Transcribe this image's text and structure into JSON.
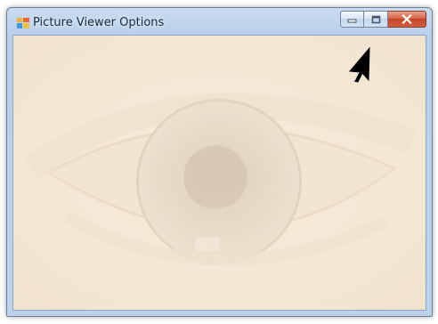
{
  "window": {
    "title": "Picture Viewer Options"
  },
  "caption_buttons": [
    {
      "name": "minimize",
      "icon": "minimize-icon"
    },
    {
      "name": "maximize",
      "icon": "maximize-icon"
    },
    {
      "name": "close",
      "icon": "close-icon"
    }
  ],
  "colors": {
    "titlebar": "#b9d0ea",
    "client_background": "#f6ead8",
    "close_button": "#c4432a"
  }
}
